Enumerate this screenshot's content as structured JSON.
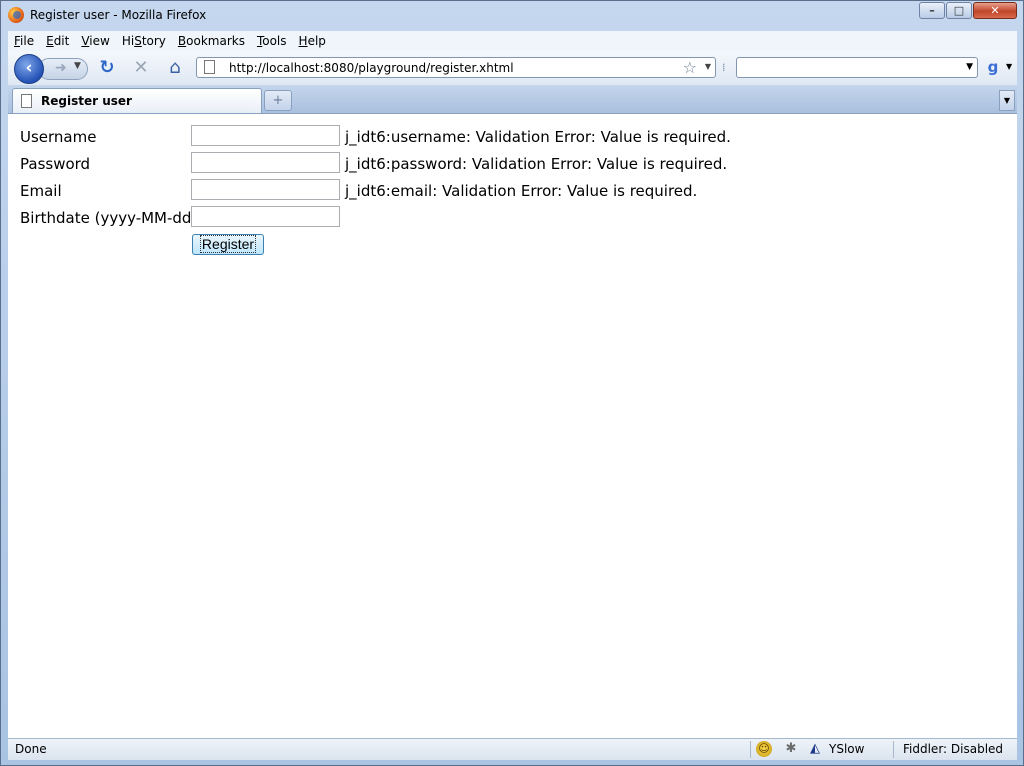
{
  "window": {
    "title": "Register user - Mozilla Firefox",
    "controls": {
      "minimize": "–",
      "maximize": "□",
      "close": "✕"
    }
  },
  "menubar": {
    "items": [
      {
        "key": "F",
        "rest": "ile"
      },
      {
        "key": "E",
        "rest": "dit"
      },
      {
        "key": "V",
        "rest": "iew"
      },
      {
        "key": "S",
        "prefix": "Hi",
        "rest": "tory"
      },
      {
        "key": "B",
        "rest": "ookmarks"
      },
      {
        "key": "T",
        "rest": "ools"
      },
      {
        "key": "H",
        "rest": "elp"
      }
    ]
  },
  "navbar": {
    "url": "http://localhost:8080/playground/register.xhtml",
    "search_value": "",
    "icons": {
      "back": "back-arrow-icon",
      "forward": "forward-arrow-icon",
      "reload": "reload-icon",
      "stop": "stop-icon",
      "home": "home-icon",
      "bookmark": "star-icon",
      "search_engine": "google-icon"
    }
  },
  "tabs": {
    "active_label": "Register user",
    "new_tab_glyph": "+"
  },
  "form": {
    "rows": [
      {
        "label": "Username",
        "value": "",
        "error": "j_idt6:username: Validation Error: Value is required."
      },
      {
        "label": "Password",
        "value": "",
        "error": "j_idt6:password: Validation Error: Value is required."
      },
      {
        "label": "Email",
        "value": "",
        "error": "j_idt6:email: Validation Error: Value is required."
      },
      {
        "label": "Birthdate (yyyy-MM-dd)",
        "value": "",
        "error": ""
      }
    ],
    "submit_label": "Register"
  },
  "statusbar": {
    "status": "Done",
    "yslow_label": "YSlow",
    "fiddler_label": "Fiddler: Disabled"
  }
}
